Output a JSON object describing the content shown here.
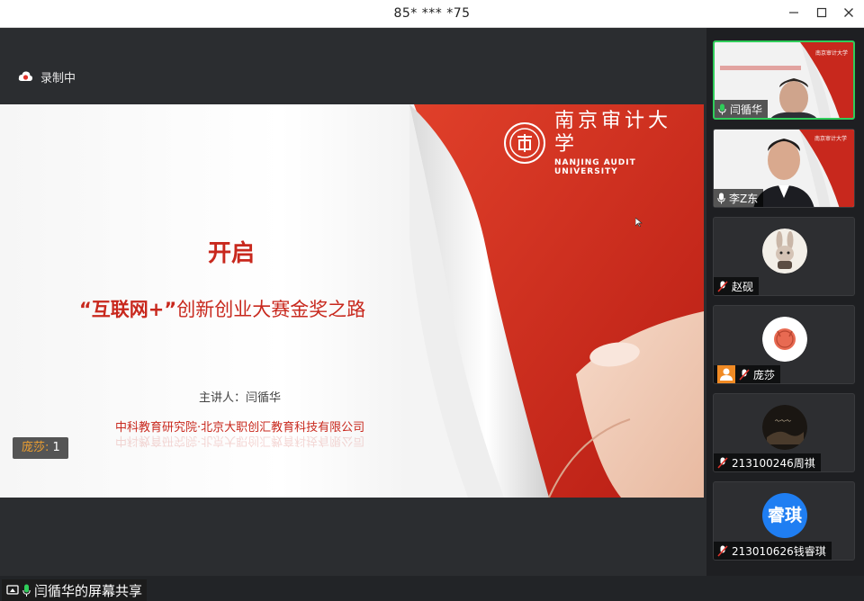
{
  "window": {
    "title": "85* *** *75"
  },
  "recording": {
    "label": "录制中"
  },
  "slide": {
    "logo_cn": "南京审计大学",
    "logo_en": "NANJING AUDIT UNIVERSITY",
    "title": "开启",
    "subtitle_quote": "“互联网+”",
    "subtitle_rest": "创新创业大赛金奖之路",
    "presenter": "主讲人：闫循华",
    "org": "中科教育研究院·北京大职创汇教育科技有限公司"
  },
  "annotation_badge": {
    "name": "庞莎:",
    "count": "1"
  },
  "share_status": {
    "text": "闫循华的屏幕共享"
  },
  "participants": [
    {
      "name": "闫循华",
      "mic": "on",
      "video": "camera"
    },
    {
      "name": "李Z东",
      "mic": "on",
      "video": "camera"
    },
    {
      "name": "赵砚",
      "mic": "muted",
      "video": "avatar"
    },
    {
      "name": "庞莎",
      "mic": "muted",
      "video": "avatar"
    },
    {
      "name": "213100246周祺",
      "mic": "muted",
      "video": "avatar"
    },
    {
      "name": "213010626钱睿琪",
      "mic": "muted",
      "video": "initials",
      "initials": "睿琪"
    }
  ],
  "colors": {
    "accent_red": "#c8281d",
    "active_green": "#2fcd5a",
    "avatar_blue": "#1f7ef2"
  }
}
